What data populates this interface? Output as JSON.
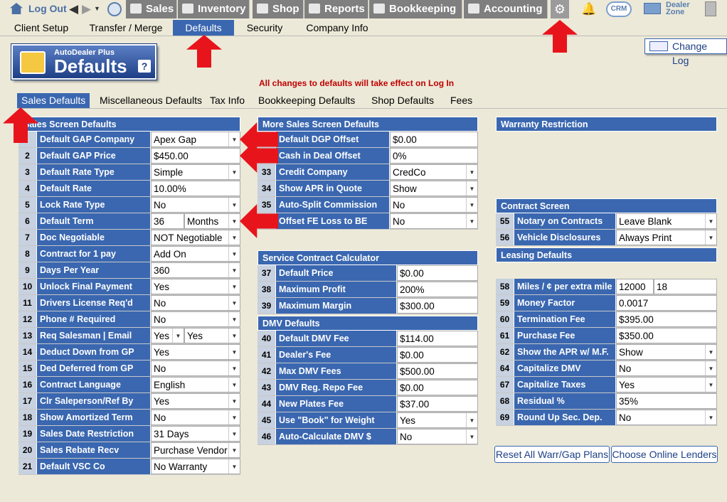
{
  "topnav": {
    "logout": "Log Out",
    "tabs": [
      "Sales",
      "Inventory",
      "Shop",
      "Reports",
      "Bookkeeping",
      "Accounting"
    ],
    "crm": "CRM",
    "dealer_zone_1": "Dealer",
    "dealer_zone_2": "Zone"
  },
  "subnav": [
    "Client Setup",
    "Transfer / Merge",
    "Defaults",
    "Security",
    "Company Info"
  ],
  "logo": {
    "small": "AutoDealer Plus",
    "big": "Defaults",
    "help": "?"
  },
  "notice": "All changes to defaults will take effect on Log In",
  "change_log": "Change Log",
  "sectabs": [
    "Sales Defaults",
    "Miscellaneous Defaults",
    "Tax Info",
    "Bookkeeping Defaults",
    "Shop Defaults",
    "Fees"
  ],
  "sales": {
    "title": "Sales Screen Defaults",
    "rows": [
      {
        "n": "",
        "l": "Default GAP Company",
        "v": "Apex Gap",
        "dd": true
      },
      {
        "n": "2",
        "l": "Default GAP Price",
        "v": "$450.00"
      },
      {
        "n": "3",
        "l": "Default Rate Type",
        "v": "Simple",
        "dd": true
      },
      {
        "n": "4",
        "l": "Default Rate",
        "v": "10.00%"
      },
      {
        "n": "5",
        "l": "Lock Rate Type",
        "v": "No",
        "dd": true
      },
      {
        "n": "6",
        "l": "Default Term",
        "v": "36",
        "v2": "Months",
        "dd": true
      },
      {
        "n": "7",
        "l": "Doc Negotiable",
        "v": "NOT Negotiable",
        "dd": true
      },
      {
        "n": "8",
        "l": "Contract for 1 pay",
        "v": "Add On",
        "dd": true
      },
      {
        "n": "9",
        "l": "Days Per Year",
        "v": "360",
        "dd": true
      },
      {
        "n": "10",
        "l": "Unlock Final Payment",
        "v": "Yes",
        "dd": true
      },
      {
        "n": "11",
        "l": "Drivers License Req'd",
        "v": "No",
        "dd": true
      },
      {
        "n": "12",
        "l": "Phone # Required",
        "v": "No",
        "dd": true
      },
      {
        "n": "13",
        "l": "Req Salesman | Email",
        "v": "Yes",
        "v2": "Yes",
        "dd": true,
        "dd1": true
      },
      {
        "n": "14",
        "l": "Deduct Down from GP",
        "v": "Yes",
        "dd": true
      },
      {
        "n": "15",
        "l": "Ded Deferred from GP",
        "v": "No",
        "dd": true
      },
      {
        "n": "16",
        "l": "Contract Language",
        "v": "English",
        "dd": true
      },
      {
        "n": "17",
        "l": "Clr Saleperson/Ref By",
        "v": "Yes",
        "dd": true
      },
      {
        "n": "18",
        "l": "Show Amortized Term",
        "v": "No",
        "dd": true
      },
      {
        "n": "19",
        "l": "Sales Date Restriction",
        "v": "31 Days",
        "dd": true
      },
      {
        "n": "20",
        "l": "Sales Rebate Recv",
        "v": "Purchase Vendor",
        "dd": true
      },
      {
        "n": "21",
        "l": "Default VSC Co",
        "v": "No Warranty",
        "dd": true
      }
    ]
  },
  "more": {
    "title": "More Sales Screen Defaults",
    "rows": [
      {
        "n": "",
        "l": "Default DGP Offset",
        "v": "$0.00"
      },
      {
        "n": "",
        "l": "Cash in Deal Offset",
        "v": "0%"
      },
      {
        "n": "33",
        "l": "Credit Company",
        "v": "CredCo",
        "dd": true
      },
      {
        "n": "34",
        "l": "Show APR in Quote",
        "v": "Show",
        "dd": true
      },
      {
        "n": "35",
        "l": "Auto-Split Commission",
        "v": "No",
        "dd": true
      },
      {
        "n": "",
        "l": "Offset FE Loss to BE",
        "v": "No",
        "dd": true
      }
    ]
  },
  "service": {
    "title": "Service Contract Calculator",
    "rows": [
      {
        "n": "37",
        "l": "Default Price",
        "v": "$0.00"
      },
      {
        "n": "38",
        "l": "Maximum Profit",
        "v": "200%"
      },
      {
        "n": "39",
        "l": "Maximum Margin",
        "v": "$300.00"
      }
    ]
  },
  "dmv": {
    "title": "DMV Defaults",
    "rows": [
      {
        "n": "40",
        "l": "Default DMV Fee",
        "v": "$114.00"
      },
      {
        "n": "41",
        "l": "Dealer's Fee",
        "v": "$0.00"
      },
      {
        "n": "42",
        "l": "Max DMV Fees",
        "v": "$500.00"
      },
      {
        "n": "43",
        "l": "DMV Reg. Repo Fee",
        "v": "$0.00"
      },
      {
        "n": "44",
        "l": "New Plates Fee",
        "v": "$37.00"
      },
      {
        "n": "45",
        "l": "Use \"Book\" for Weight",
        "v": "Yes",
        "dd": true
      },
      {
        "n": "46",
        "l": "Auto-Calculate DMV $",
        "v": "No",
        "dd": true
      }
    ]
  },
  "warranty": {
    "title": "Warranty Restriction"
  },
  "contract": {
    "title": "Contract Screen",
    "rows": [
      {
        "n": "55",
        "l": "Notary on Contracts",
        "v": "Leave Blank",
        "dd": true
      },
      {
        "n": "56",
        "l": "Vehicle Disclosures",
        "v": "Always Print",
        "dd": true
      }
    ]
  },
  "leasing": {
    "title": "Leasing Defaults",
    "rows": [
      {
        "n": "58",
        "l": "Miles / ¢ per extra mile",
        "v": "12000",
        "v2": "18"
      },
      {
        "n": "59",
        "l": "Money Factor",
        "v": "0.0017"
      },
      {
        "n": "60",
        "l": "Termination Fee",
        "v": "$395.00"
      },
      {
        "n": "61",
        "l": "Purchase Fee",
        "v": "$350.00"
      },
      {
        "n": "62",
        "l": "Show the APR w/ M.F.",
        "v": "Show",
        "dd": true
      },
      {
        "n": "64",
        "l": "Capitalize DMV",
        "v": "No",
        "dd": true
      },
      {
        "n": "67",
        "l": "Capitalize Taxes",
        "v": "Yes",
        "dd": true
      },
      {
        "n": "68",
        "l": "Residual %",
        "v": "35%"
      },
      {
        "n": "69",
        "l": "Round Up Sec. Dep.",
        "v": "No",
        "dd": true
      }
    ]
  },
  "buttons": {
    "reset": "Reset All Warr/Gap Plans",
    "lenders": "Choose Online Lenders"
  }
}
